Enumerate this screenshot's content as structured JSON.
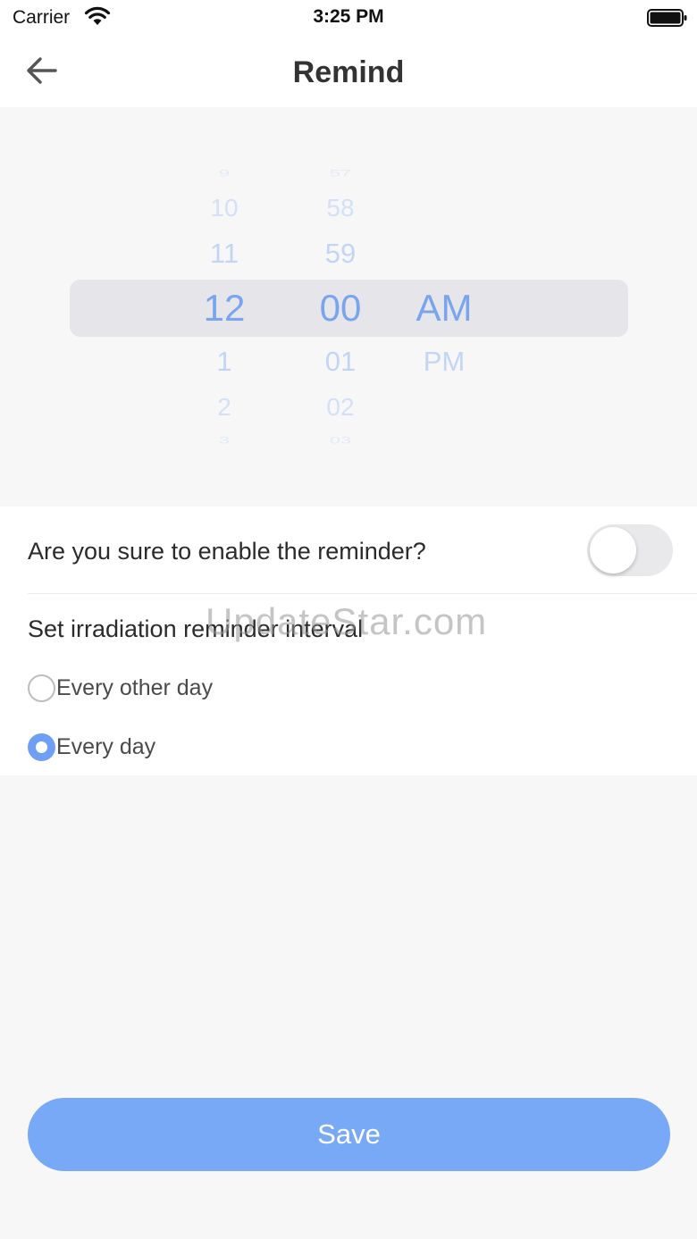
{
  "status_bar": {
    "carrier": "Carrier",
    "time": "3:25 PM"
  },
  "nav": {
    "title": "Remind",
    "back_icon": "arrow-left-icon"
  },
  "time_picker": {
    "hours": [
      "9",
      "10",
      "11",
      "12",
      "1",
      "2",
      "3"
    ],
    "minutes": [
      "57",
      "58",
      "59",
      "00",
      "01",
      "02",
      "03"
    ],
    "periods": [
      "AM",
      "PM"
    ],
    "selected_hour": "12",
    "selected_minute": "00",
    "selected_period": "AM"
  },
  "settings": {
    "enable_label": "Are you sure to enable the reminder?",
    "enable_on": false,
    "interval_label": "Set irradiation reminder interval",
    "options": [
      {
        "label": "Every other day",
        "checked": false
      },
      {
        "label": "Every day",
        "checked": true
      }
    ]
  },
  "watermark": "UpdateStar.com",
  "save_label": "Save",
  "colors": {
    "accent": "#78a9f6",
    "picker_text": "#78a4f0"
  }
}
